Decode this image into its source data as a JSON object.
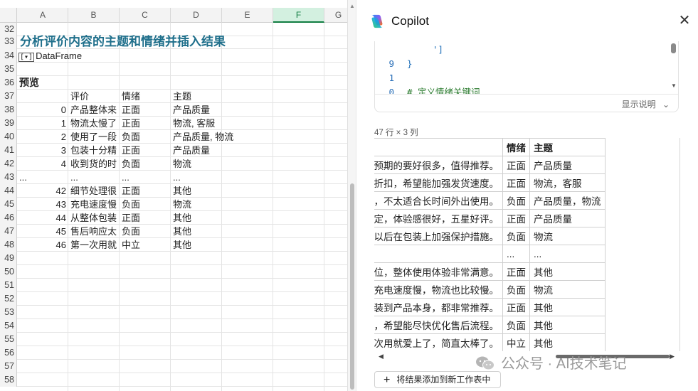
{
  "sheet": {
    "columns": [
      "A",
      "B",
      "C",
      "D",
      "E",
      "F",
      "G"
    ],
    "selected_column": "F",
    "row_numbers": [
      "32",
      "33",
      "34",
      "35",
      "36",
      "37",
      "38",
      "39",
      "40",
      "41",
      "42",
      "43",
      "44",
      "45",
      "46",
      "47",
      "48",
      "49",
      "50",
      "51",
      "52",
      "53",
      "54",
      "55",
      "56",
      "57",
      "58"
    ],
    "title": "分析评价内容的主题和情绪并插入结果",
    "dataframe_icon": "[▾]",
    "dataframe_label": "DataFrame",
    "preview_label": "预览",
    "headers": {
      "review": "评价",
      "sentiment": "情绪",
      "topic": "主题"
    },
    "rows": [
      {
        "idx": "0",
        "review": "产品整体来",
        "sentiment": "正面",
        "topic": "产品质量"
      },
      {
        "idx": "1",
        "review": "物流太慢了",
        "sentiment": "正面",
        "topic": "物流, 客服"
      },
      {
        "idx": "2",
        "review": "使用了一段",
        "sentiment": "负面",
        "topic": "产品质量, 物流"
      },
      {
        "idx": "3",
        "review": "包装十分精",
        "sentiment": "正面",
        "topic": "产品质量"
      },
      {
        "idx": "4",
        "review": "收到货的时",
        "sentiment": "负面",
        "topic": "物流"
      },
      {
        "idx": "...",
        "review": "...",
        "sentiment": "...",
        "topic": "..."
      },
      {
        "idx": "42",
        "review": "细节处理很",
        "sentiment": "正面",
        "topic": "其他"
      },
      {
        "idx": "43",
        "review": "充电速度慢",
        "sentiment": "负面",
        "topic": "物流"
      },
      {
        "idx": "44",
        "review": "从整体包装",
        "sentiment": "正面",
        "topic": "其他"
      },
      {
        "idx": "45",
        "review": "售后响应太",
        "sentiment": "负面",
        "topic": "其他"
      },
      {
        "idx": "46",
        "review": "第一次用就",
        "sentiment": "中立",
        "topic": "其他"
      }
    ]
  },
  "copilot": {
    "title": "Copilot",
    "close_icon": "close-icon",
    "code_lines": [
      {
        "ln": "",
        "text": "']",
        "kind": "code"
      },
      {
        "ln": "9",
        "text": "}",
        "kind": "code"
      },
      {
        "ln": "1",
        "text": "",
        "kind": "code"
      },
      {
        "ln": "0",
        "text": "# 定义情绪关键词",
        "kind": "comment"
      }
    ],
    "show_explanation": "显示说明",
    "rows_info": "47 行 × 3 列",
    "table": {
      "headers": [
        "",
        "情绪",
        "主题"
      ],
      "rows": [
        [
          "产品整体来说还不错，质量比预期的要好很多，值得推荐。",
          "正面",
          "产品质量"
        ],
        [
          "物流太慢了，等了好久才到，体验感打了折扣，希望能加强发货速度。",
          "正面",
          "物流，客服"
        ],
        [
          "使用了一段时间后发现电池续航下降速度异常快，不太适合长时间外出使用。",
          "负面",
          "产品质量，物流"
        ],
        [
          "包装十分精致，质量也很好，性能也非常稳定，体验感很好，五星好评。",
          "正面",
          "产品质量"
        ],
        [
          "收到货的时候外包装破损，有点问题，建议以后在包装上加强保护措施。",
          "负面",
          "物流"
        ],
        [
          "...",
          "...",
          "..."
        ],
        [
          "细节处理很到位，整体使用体验非常满意。",
          "正面",
          "其他"
        ],
        [
          "充电速度慢，物流也比较慢。",
          "负面",
          "物流"
        ],
        [
          "从整体包装到产品本身，都非常推荐。",
          "正面",
          "其他"
        ],
        [
          "售后响应太慢，希望能尽快优化售后流程。",
          "负面",
          "其他"
        ],
        [
          "第一次用就爱上了，简直太棒了。",
          "中立",
          "其他"
        ]
      ]
    },
    "add_button": "将结果添加到新工作表中"
  },
  "watermark": "公众号 · AI技术笔记",
  "colors": {
    "accent_green": "#107c41",
    "title_teal": "#1f6f8b",
    "code_blue": "#1e6fb8",
    "comment_green": "#2e7d32"
  }
}
